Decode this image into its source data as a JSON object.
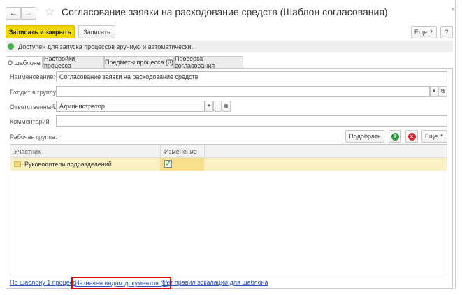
{
  "window": {
    "title": "Согласование заявки на расходование средств (Шаблон согласования)",
    "back": "←",
    "forward": "→",
    "star": "☆",
    "close": "×"
  },
  "toolbar": {
    "save_close": "Записать и закрыть",
    "save": "Записать",
    "more": "Еще",
    "help": "?"
  },
  "status": {
    "text": "Доступен для запуска процессов вручную и автоматически.",
    "color": "#4caf50"
  },
  "tabs": [
    {
      "label": "О шаблоне",
      "active": true
    },
    {
      "label": "Настройки процесса"
    },
    {
      "label": "Предметы процесса (3)"
    },
    {
      "label": "Проверка согласования"
    }
  ],
  "form": {
    "name_label": "Наименование:",
    "name_value": "Согласование заявки на расходование средств",
    "group_label": "Входит в группу:",
    "group_value": "",
    "responsible_label": "Ответственный:",
    "responsible_value": "Администратор",
    "comment_label": "Комментарий:",
    "comment_value": ""
  },
  "workgroup": {
    "label": "Рабочая группа:",
    "pick": "Подобрать",
    "more": "Еще",
    "columns": [
      "Участник",
      "Изменение"
    ],
    "rows": [
      {
        "participant": "Руководители подразделений",
        "change": true
      }
    ]
  },
  "links": [
    "По шаблону 1 процесс",
    "Назначен видам документов (1)",
    "Нет правил эскалации для шаблона"
  ],
  "colors": {
    "accent": "#f5d800",
    "highlight_row": "#fbf0c4",
    "link_box": "#e00000"
  }
}
